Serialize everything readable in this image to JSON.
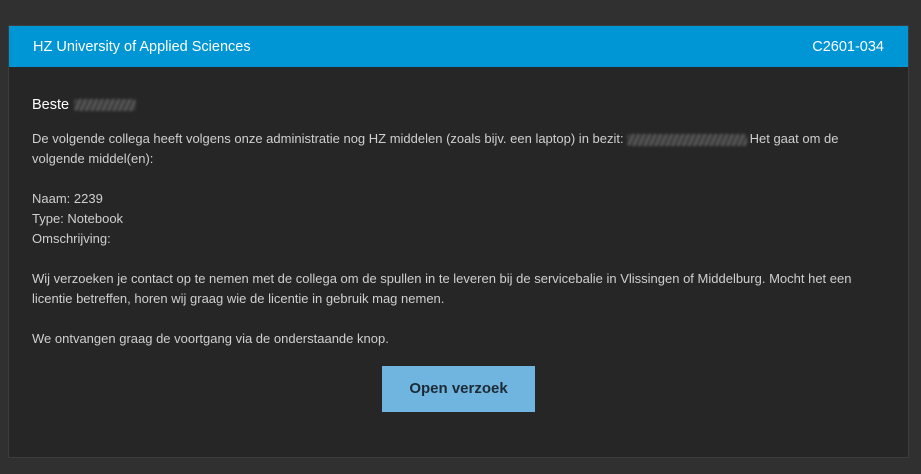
{
  "header": {
    "organization": "HZ University of Applied Sciences",
    "reference": "C2601-034"
  },
  "message": {
    "greeting": "Beste",
    "intro_before": "De volgende collega heeft volgens onze administratie nog HZ middelen (zoals bijv. een laptop) in bezit:",
    "intro_after": "Het gaat om de volgende middel(en):",
    "item_name": "Naam: 2239",
    "item_type": "Type: Notebook",
    "item_description": "Omschrijving:",
    "request": "Wij verzoeken je contact op te nemen met de collega om de spullen in te leveren bij de servicebalie in Vlissingen of Middelburg. Mocht het een licentie betreffen, horen wij graag wie de licentie in gebruik mag nemen.",
    "closing": "We ontvangen graag de voortgang via de onderstaande knop."
  },
  "button": {
    "label": "Open verzoek"
  },
  "colors": {
    "header_bg": "#0095d5",
    "button_bg": "#6fb5df",
    "page_bg": "#303030",
    "card_bg": "#262626"
  }
}
